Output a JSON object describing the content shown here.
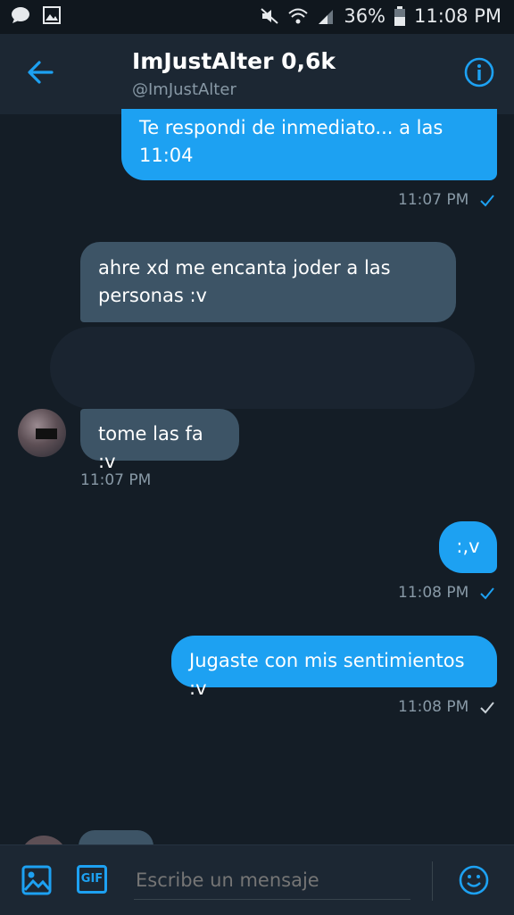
{
  "status": {
    "battery": "36%",
    "time": "11:08 PM"
  },
  "header": {
    "title": "ImJustAlter 0,6k",
    "handle": "@ImJustAlter"
  },
  "messages": [
    {
      "text": "Te respondi de inmediato... a las 11:04",
      "time": "11:07 PM",
      "status": "sent"
    },
    {
      "text": "ahre xd me encanta joder a las personas :v"
    },
    {
      "text": "tome las fa :v",
      "time": "11:07 PM"
    },
    {
      "text": ":,v",
      "time": "11:08 PM",
      "status": "sent"
    },
    {
      "text": "Jugaste con mis sentimientos :v",
      "time": "11:08 PM",
      "status": "read"
    }
  ],
  "composer": {
    "placeholder": "Escribe un mensaje",
    "gif_label": "GIF"
  },
  "colors": {
    "accent": "#1da1f2",
    "background": "#141d26",
    "incoming_bubble": "#3d5466"
  },
  "icons": [
    "notification-icon",
    "gallery-icon",
    "mute-icon",
    "wifi-icon",
    "signal-icon",
    "battery-icon",
    "back-arrow-icon",
    "info-icon",
    "image-icon",
    "gif-icon",
    "emoji-icon",
    "check-icon"
  ]
}
